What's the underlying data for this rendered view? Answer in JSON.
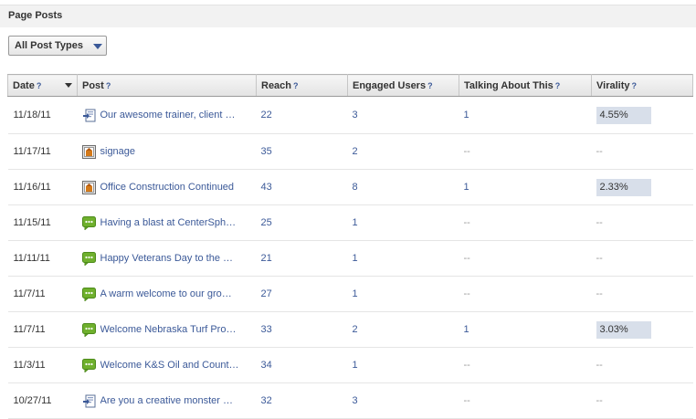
{
  "header": {
    "title": "Page Posts"
  },
  "filter": {
    "label": "All Post Types"
  },
  "table": {
    "columns": [
      {
        "label": "Date",
        "help": "?"
      },
      {
        "label": "Post",
        "help": "?"
      },
      {
        "label": "Reach",
        "help": "?"
      },
      {
        "label": "Engaged Users",
        "help": "?"
      },
      {
        "label": "Talking About This",
        "help": "?"
      },
      {
        "label": "Virality",
        "help": "?"
      }
    ],
    "rows": [
      {
        "date": "11/18/11",
        "icon": "link-icon",
        "post": "Our awesome trainer, client …",
        "reach": "22",
        "engaged": "3",
        "talking": "1",
        "virality": "4.55%"
      },
      {
        "date": "11/17/11",
        "icon": "photo-icon",
        "post": "signage",
        "reach": "35",
        "engaged": "2",
        "talking": "--",
        "virality": "--"
      },
      {
        "date": "11/16/11",
        "icon": "photo-icon",
        "post": "Office Construction Continued",
        "reach": "43",
        "engaged": "8",
        "talking": "1",
        "virality": "2.33%"
      },
      {
        "date": "11/15/11",
        "icon": "status-icon",
        "post": "Having a blast at CenterSph…",
        "reach": "25",
        "engaged": "1",
        "talking": "--",
        "virality": "--"
      },
      {
        "date": "11/11/11",
        "icon": "status-icon",
        "post": "Happy Veterans Day to the …",
        "reach": "21",
        "engaged": "1",
        "talking": "--",
        "virality": "--"
      },
      {
        "date": "11/7/11",
        "icon": "status-icon",
        "post": "A warm welcome to our gro…",
        "reach": "27",
        "engaged": "1",
        "talking": "--",
        "virality": "--"
      },
      {
        "date": "11/7/11",
        "icon": "status-icon",
        "post": "Welcome Nebraska Turf Pro…",
        "reach": "33",
        "engaged": "2",
        "talking": "1",
        "virality": "3.03%"
      },
      {
        "date": "11/3/11",
        "icon": "status-icon",
        "post": "Welcome K&S Oil and Count…",
        "reach": "34",
        "engaged": "1",
        "talking": "--",
        "virality": "--"
      },
      {
        "date": "10/27/11",
        "icon": "link-icon",
        "post": "Are you a creative monster …",
        "reach": "32",
        "engaged": "3",
        "talking": "--",
        "virality": "--"
      }
    ]
  }
}
